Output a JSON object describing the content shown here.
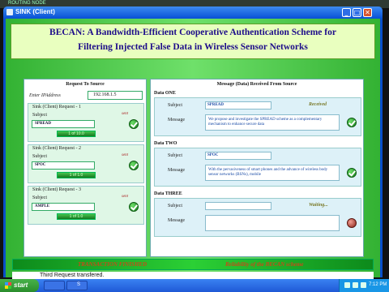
{
  "topstrip": {
    "text": "ROUTING NODE"
  },
  "window": {
    "title": "SINK (Client)",
    "buttons": {
      "minimize": "_",
      "maximize": "□",
      "close": "✕"
    }
  },
  "banner": {
    "line1": "BECAN: A Bandwidth-Efficient Cooperative Authentication Scheme for",
    "line2": "Filtering Injected False Data in Wireless Sensor Networks"
  },
  "request_panel": {
    "title": "Request To Source",
    "ip_label": "Enter IPAddress",
    "ip_value": "192.168.1.5",
    "requests": [
      {
        "title": "Sink (Client) Request - 1",
        "subject_label": "Subject",
        "sent_label": "sent",
        "subject": "SPREAD",
        "progress_text": "1 of 10.0",
        "progress": 1.0
      },
      {
        "title": "Sink (Client) Request - 2",
        "subject_label": "Subject",
        "sent_label": "sent",
        "subject": "SPOC",
        "progress_text": "1 of 1.0",
        "progress": 1.0
      },
      {
        "title": "Sink (Client) Request - 3",
        "subject_label": "Subject",
        "sent_label": "sent",
        "subject": "AMPLE",
        "progress_text": "1 of 1.0",
        "progress": 1.0
      }
    ]
  },
  "received_panel": {
    "title": "Message (Data) Received  From Source",
    "items": [
      {
        "label": "Data ONE",
        "subject_label": "Subject",
        "message_label": "Message",
        "subject": "SPREAD",
        "status": "Received",
        "message": "We propose and investigate the SPREAD scheme as a complementary mechanism to enhance secure data"
      },
      {
        "label": "Data TWO",
        "subject_label": "Subject",
        "message_label": "Message",
        "subject": "SPOC",
        "status": "",
        "message": "With the pervasiveness of smart phones and the advance of wireless body sensor networks (BSNs), mobile"
      },
      {
        "label": "Data THREE",
        "subject_label": "Subject",
        "message_label": "Message",
        "subject": "",
        "status": "Waiting...",
        "message": ""
      }
    ]
  },
  "status_strip": {
    "done": "TRANSACTION FINISHED",
    "auth": "Reliability of the BECAN scheme"
  },
  "message_bar": {
    "text": "Third Request transfered."
  },
  "taskbar": {
    "start_label": "start",
    "buttons": [
      "",
      "S"
    ],
    "clock": "7:12 PM"
  },
  "colors": {
    "title_text": "#1d0c8a",
    "accent_green": "#33b233",
    "status_orange": "#c84a19"
  },
  "icons": {
    "received": "check-circle-icon",
    "pending": "red-dot-icon"
  }
}
